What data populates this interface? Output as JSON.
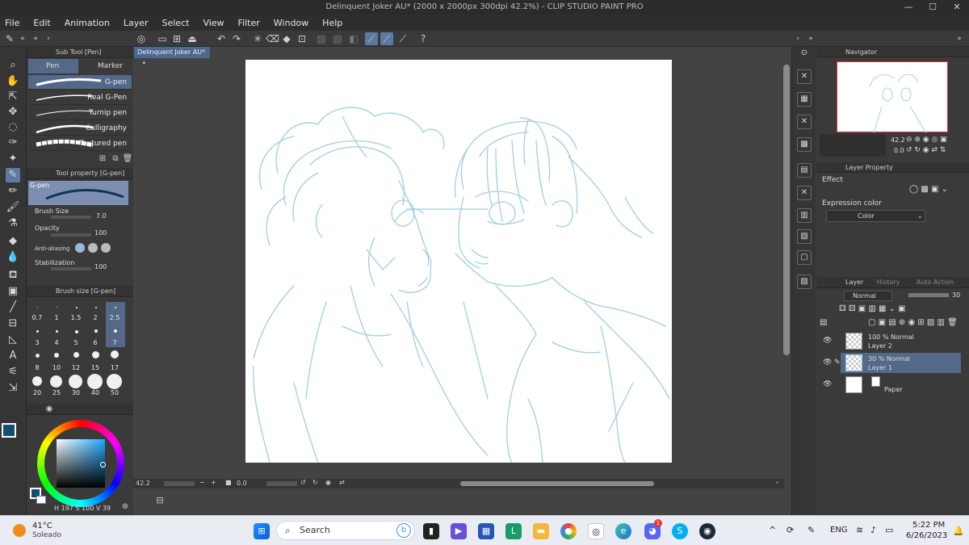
{
  "window": {
    "title": "Delinquent Joker AU* (2000 x 2000px 300dpi 42.2%)  - CLIP STUDIO PAINT PRO"
  },
  "menu": [
    "File",
    "Edit",
    "Animation",
    "Layer",
    "Select",
    "View",
    "Filter",
    "Window",
    "Help"
  ],
  "subtool": {
    "panel_title": "Sub Tool [Pen]",
    "tabs": [
      "Pen",
      "Marker"
    ],
    "brushes": [
      "G-pen",
      "Real G-Pen",
      "Turnip pen",
      "Calligraphy",
      "Textured pen"
    ]
  },
  "tool_property": {
    "panel_title": "Tool property [G-pen]",
    "preview_label": "G-pen",
    "brush_size_label": "Brush Size",
    "brush_size_value": "7.0",
    "opacity_label": "Opacity",
    "opacity_value": "100",
    "antialias_label": "Anti-aliasing",
    "stabilization_label": "Stabilization",
    "stabilization_value": "100"
  },
  "brush_size_panel": {
    "panel_title": "Brush size [G-pen]",
    "row1": [
      "0.7",
      "1",
      "1.5",
      "2",
      "2.5"
    ],
    "row2": [
      "3",
      "4",
      "5",
      "6",
      "7"
    ],
    "row3": [
      "8",
      "10",
      "12",
      "15",
      "17"
    ],
    "row4": [
      "20",
      "25",
      "30",
      "40",
      "50"
    ],
    "selected": "7"
  },
  "color": {
    "main": "#0f4f73",
    "sub": "#ffffff",
    "readout": "197",
    "readout2": "100",
    "readout3": "39"
  },
  "document": {
    "tab_label": "Delinquent Joker AU*",
    "zoom": "42.2",
    "angle": "0.0"
  },
  "navigator": {
    "title": "Navigator",
    "zoom": "42.2",
    "angle": "0.0"
  },
  "layer_property": {
    "title": "Layer Property",
    "effect_label": "Effect",
    "expression_label": "Expression color",
    "expression_value": "Color"
  },
  "layers_panel": {
    "tabs": [
      "Layer",
      "History",
      "Auto Action"
    ],
    "blend_mode": "Normal",
    "opacity": "30",
    "layers": [
      {
        "info": "100 % Normal",
        "name": "Layer 2"
      },
      {
        "info": "30 % Normal",
        "name": "Layer 1"
      },
      {
        "info": "",
        "name": "Paper"
      }
    ]
  },
  "taskbar": {
    "weather_temp": "41°C",
    "weather_desc": "Soleado",
    "search_placeholder": "Search",
    "language": "ENG",
    "time": "5:22 PM",
    "date": "6/26/2023",
    "discord_badge": "1"
  }
}
